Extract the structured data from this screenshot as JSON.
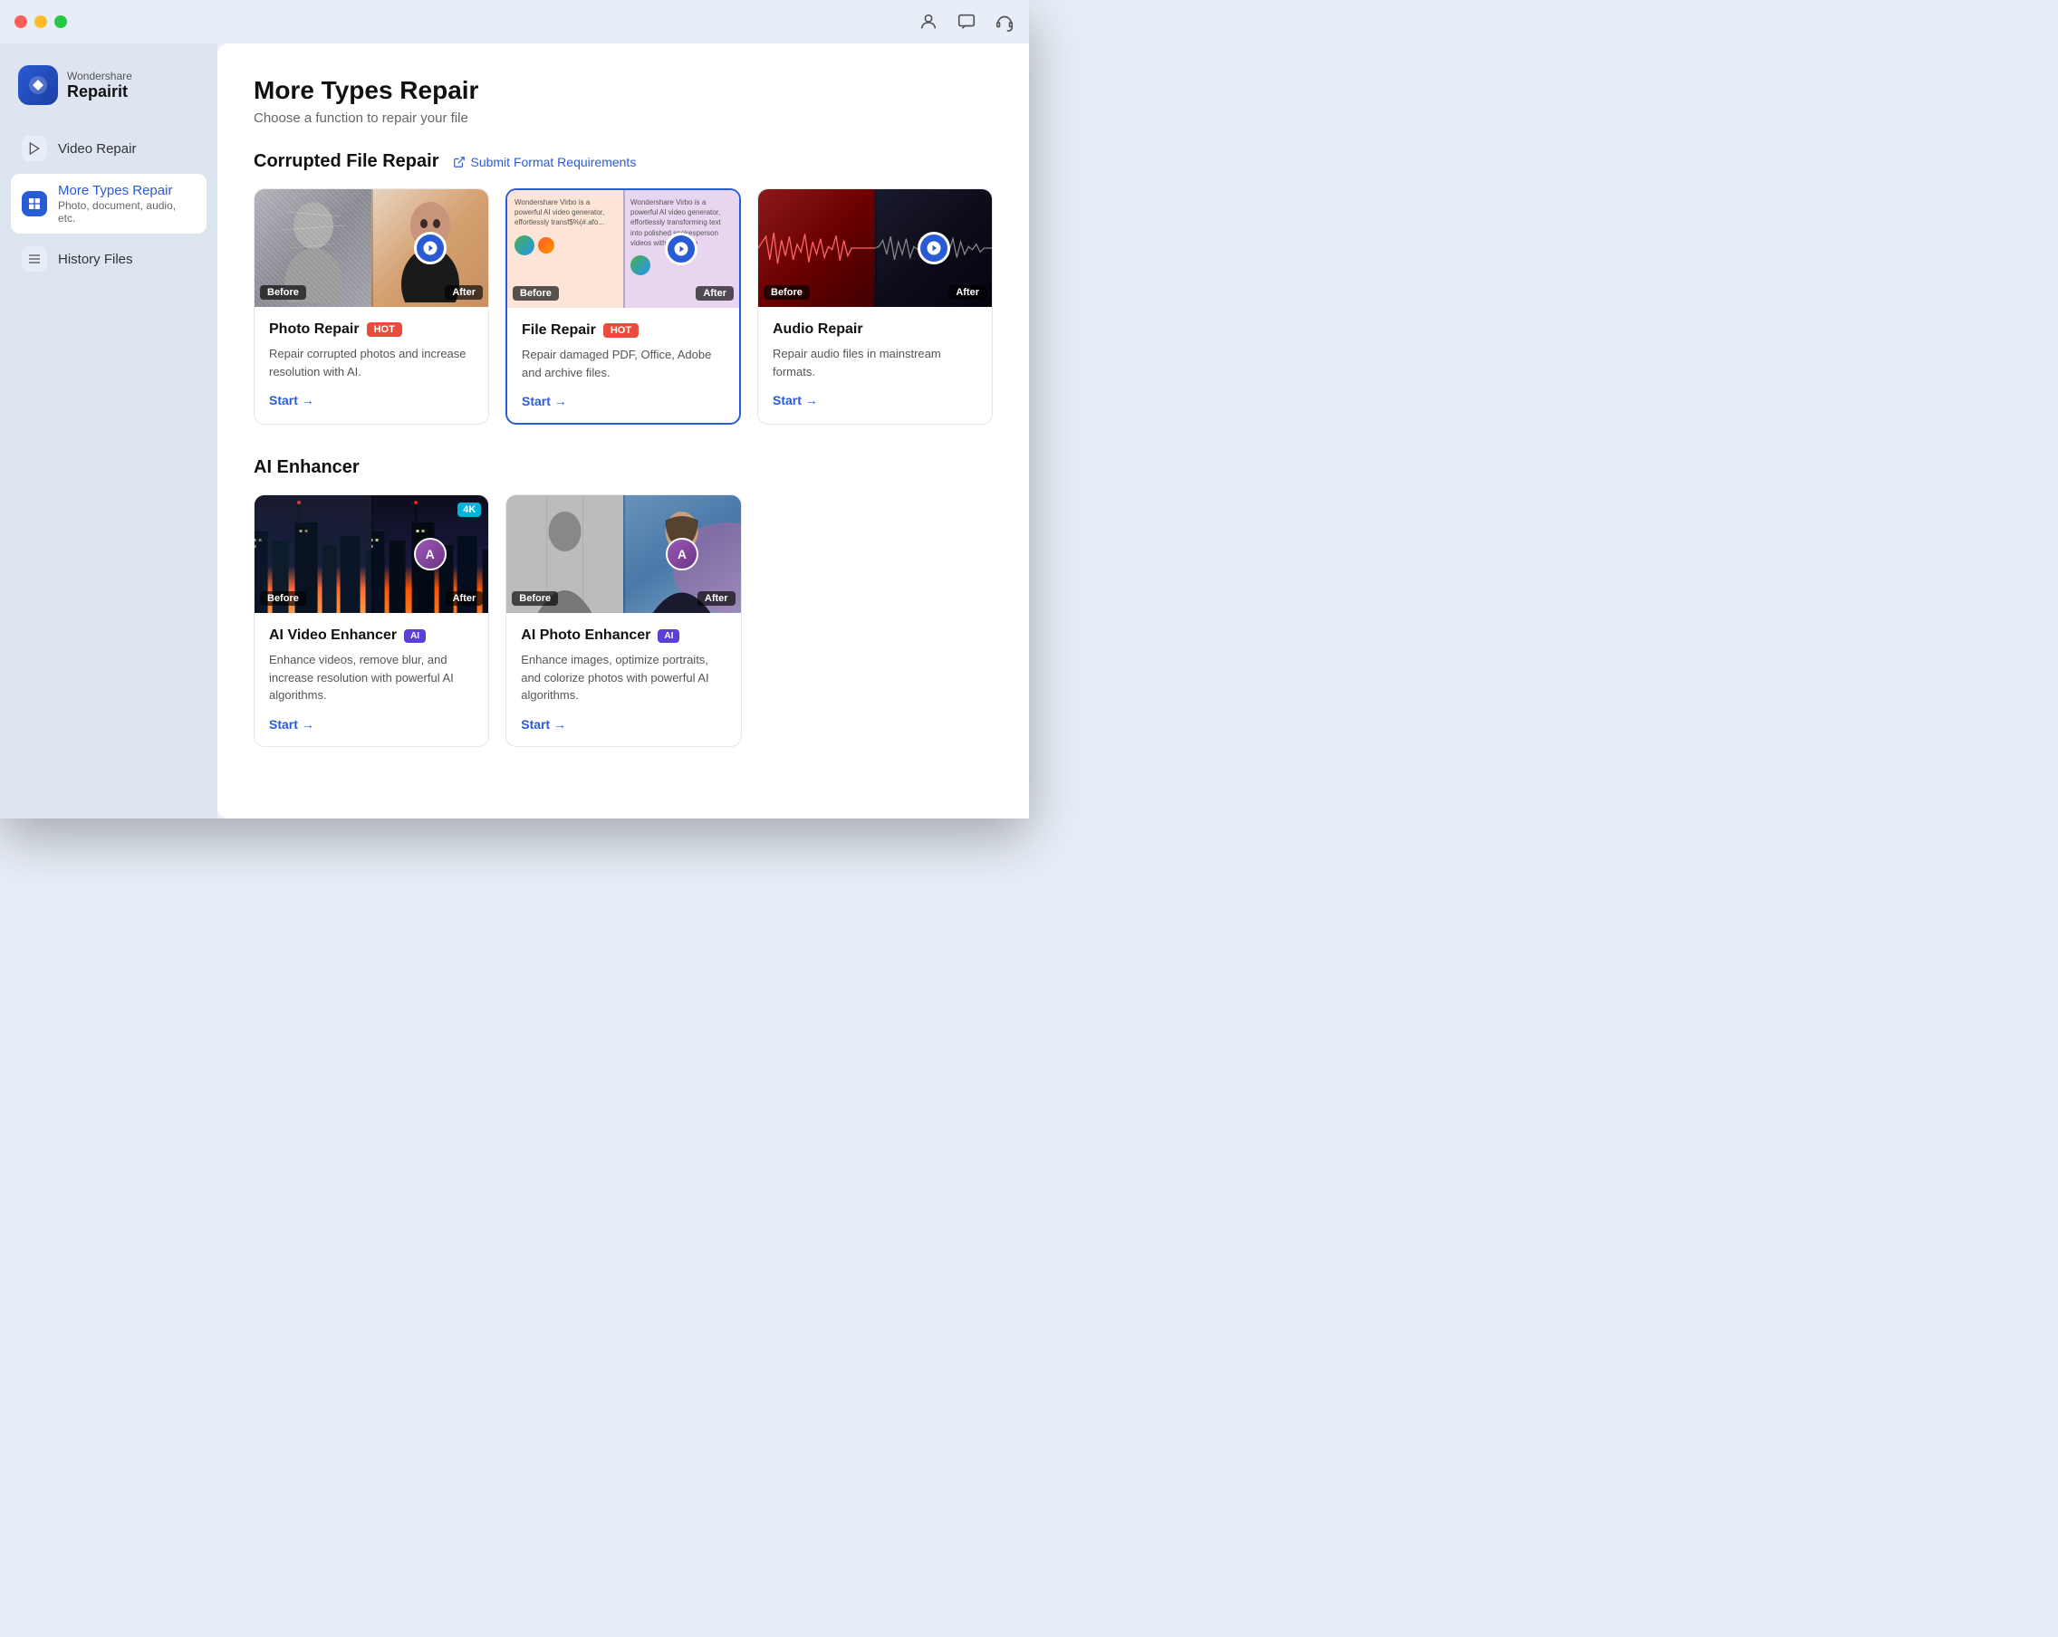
{
  "window": {
    "title": "Wondershare Repairit"
  },
  "brand": {
    "name_top": "Wondershare",
    "name_bottom": "Repairit"
  },
  "sidebar": {
    "items": [
      {
        "id": "video-repair",
        "label": "Video Repair",
        "sub": "",
        "active": false
      },
      {
        "id": "more-types-repair",
        "label": "More Types Repair",
        "sub": "Photo, document, audio, etc.",
        "active": true
      },
      {
        "id": "history-files",
        "label": "History Files",
        "sub": "",
        "active": false
      }
    ]
  },
  "main": {
    "title": "More Types Repair",
    "subtitle": "Choose a function to repair your file",
    "sections": [
      {
        "id": "corrupted-file-repair",
        "title": "Corrupted File Repair",
        "link_label": "Submit Format Requirements",
        "cards": [
          {
            "id": "photo-repair",
            "title": "Photo Repair",
            "badge": "HOT",
            "badge_type": "hot",
            "description": "Repair corrupted photos and increase resolution with AI.",
            "start_label": "Start →",
            "selected": false
          },
          {
            "id": "file-repair",
            "title": "File Repair",
            "badge": "HOT",
            "badge_type": "hot",
            "description": "Repair damaged PDF, Office, Adobe and archive files.",
            "start_label": "Start →",
            "selected": true
          },
          {
            "id": "audio-repair",
            "title": "Audio Repair",
            "badge": "",
            "badge_type": "",
            "description": "Repair audio files in mainstream formats.",
            "start_label": "Start →",
            "selected": false
          }
        ]
      },
      {
        "id": "ai-enhancer",
        "title": "AI Enhancer",
        "link_label": "",
        "cards": [
          {
            "id": "ai-video-enhancer",
            "title": "AI Video Enhancer",
            "badge": "AI",
            "badge_type": "ai",
            "description": "Enhance videos, remove blur, and increase resolution with powerful AI algorithms.",
            "start_label": "Start →",
            "selected": false,
            "extra_badge": "4K"
          },
          {
            "id": "ai-photo-enhancer",
            "title": "AI Photo Enhancer",
            "badge": "AI",
            "badge_type": "ai",
            "description": "Enhance images, optimize portraits, and colorize photos with powerful AI algorithms.",
            "start_label": "Start →",
            "selected": false,
            "extra_badge": ""
          }
        ]
      }
    ]
  },
  "labels": {
    "before": "Before",
    "after": "After",
    "start_arrow": "Start →"
  }
}
